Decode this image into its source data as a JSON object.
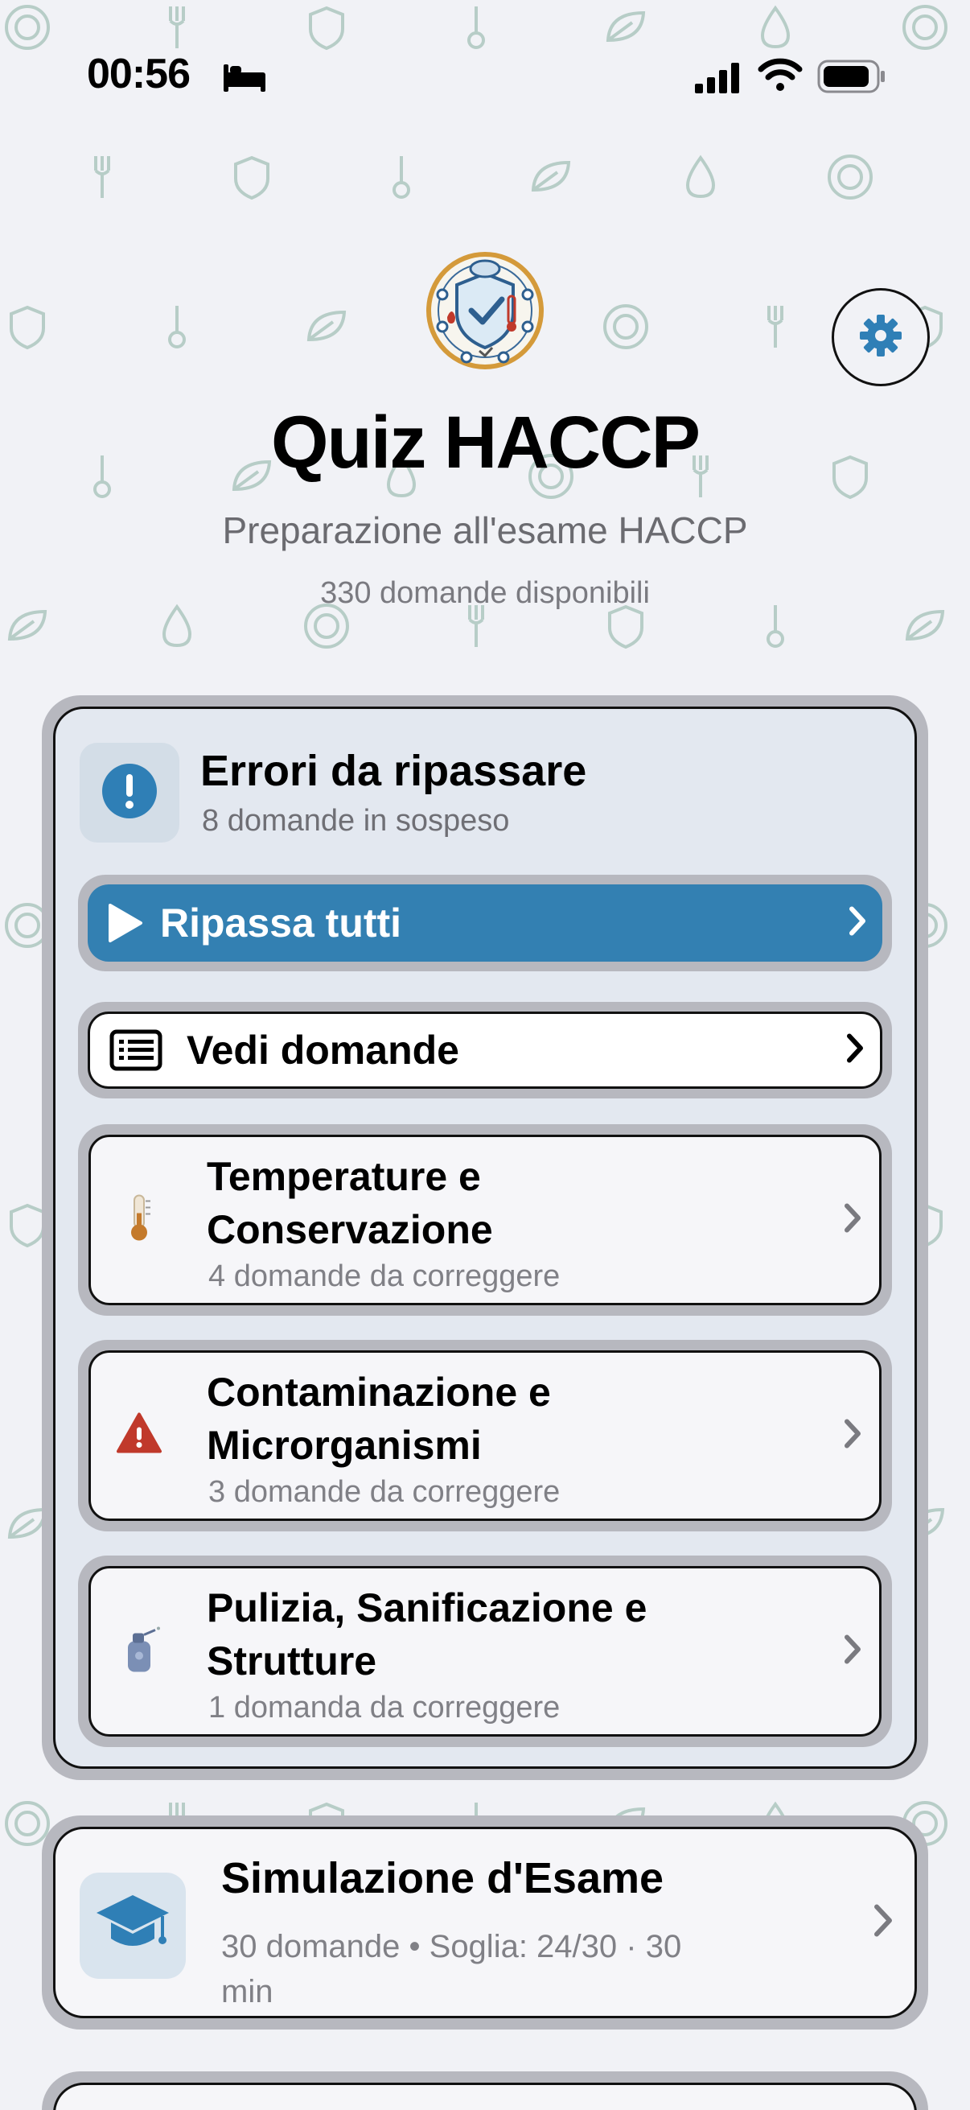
{
  "status_bar": {
    "time": "00:56",
    "icons": [
      "bed-icon",
      "cellular-signal-icon",
      "wifi-icon",
      "battery-icon"
    ]
  },
  "header": {
    "logo": "haccp-shield-logo",
    "title": "Quiz HACCP",
    "subtitle": "Preparazione all'esame HACCP",
    "question_count": "330 domande disponibili",
    "settings_icon": "gear-icon"
  },
  "errors_section": {
    "title": "Errori da ripassare",
    "subtitle": "8 domande in sospeso",
    "icon": "exclamation-circle-icon",
    "review_all_label": "Ripassa tutti",
    "see_questions_label": "Vedi domande",
    "categories": [
      {
        "title": "Temperature e Conservazione",
        "subtitle": "4 domande da correggere",
        "icon": "thermometer-icon"
      },
      {
        "title": "Contaminazione e Microrganismi",
        "subtitle": "3 domande da correggere",
        "icon": "warning-triangle-icon"
      },
      {
        "title": "Pulizia, Sanificazione e Strutture",
        "subtitle": "1 domanda da correggere",
        "icon": "spray-bottle-icon"
      }
    ]
  },
  "exam_section": {
    "title": "Simulazione d'Esame",
    "subtitle": "30 domande • Soglia: 24/30 · 30 min",
    "icon": "graduation-cap-icon"
  },
  "colors": {
    "background": "#f1f2f6",
    "accent": "#3380b2",
    "card_border": "#b7b8bf",
    "errors_bg": "#e3e8f0",
    "pattern": "#b7cdc7"
  }
}
